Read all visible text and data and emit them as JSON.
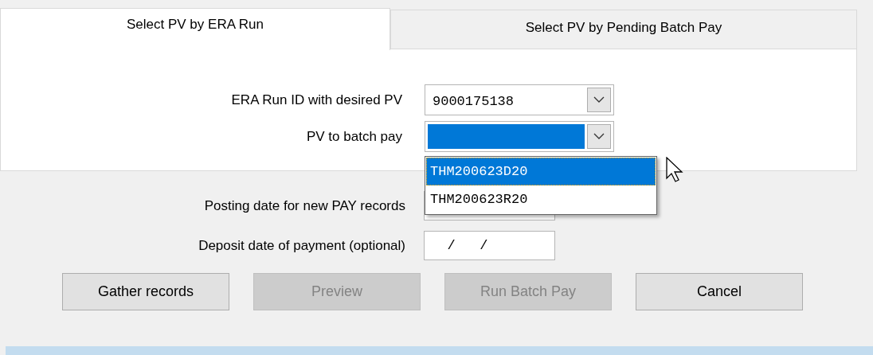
{
  "tabs": [
    {
      "label": "Select PV by ERA Run",
      "selected": true
    },
    {
      "label": "Select PV by Pending Batch Pay",
      "selected": false
    }
  ],
  "era_run": {
    "label": "ERA Run ID with desired PV",
    "value": "9000175138"
  },
  "pv": {
    "label": "PV to batch pay",
    "focused": true,
    "expanded": true,
    "options": [
      {
        "label": "THM200623D20",
        "selected": true
      },
      {
        "label": "THM200623R20",
        "selected": false
      }
    ]
  },
  "posting_date": {
    "label": "Posting date for new PAY records"
  },
  "deposit_date": {
    "label": "Deposit date of payment (optional)",
    "value": "  /   /"
  },
  "buttons": [
    {
      "label": "Gather records",
      "disabled": false
    },
    {
      "label": "Preview",
      "disabled": true
    },
    {
      "label": "Run Batch Pay",
      "disabled": true
    },
    {
      "label": "Cancel",
      "disabled": false
    }
  ]
}
